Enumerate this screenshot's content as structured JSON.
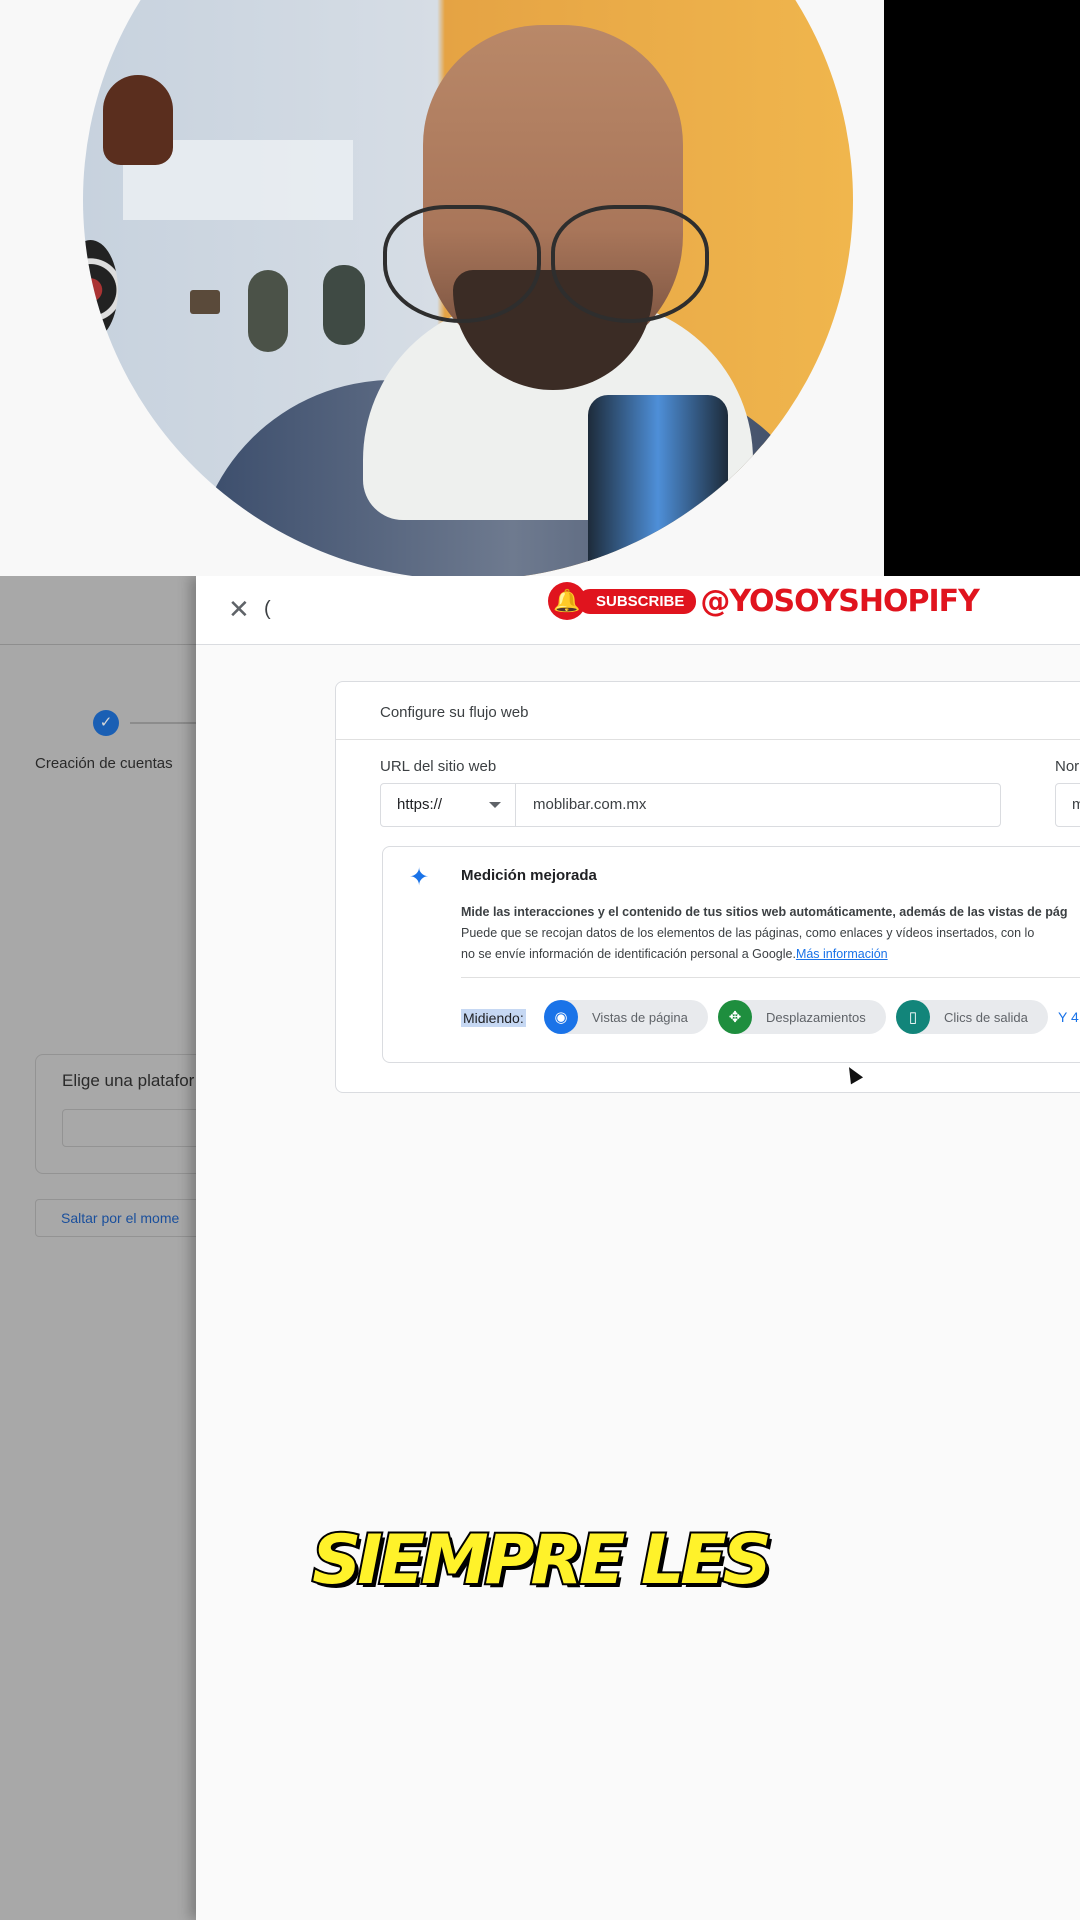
{
  "overlay": {
    "subscribe_label": "SUBSCRIBE",
    "channel_handle": "@YOSOYSHOPIFY",
    "caption": "SIEMPRE LES"
  },
  "background_page": {
    "step_label": "Creación de cuentas",
    "platform_card_title": "Elige una platafor",
    "skip_link": "Saltar por el mome"
  },
  "dialog": {
    "header_partial": "(",
    "card_title": "Configure su flujo web",
    "url_label": "URL del sitio web",
    "protocol_value": "https://",
    "url_value": "moblibar.com.mx",
    "name_label_partial": "Nor",
    "name_value_partial": "m",
    "enhanced": {
      "title": "Medición mejorada",
      "desc_line1": "Mide las interacciones y el contenido de tus sitios web automáticamente, además de las vistas de pág",
      "desc_line2": "Puede que se recojan datos de los elementos de las páginas, como enlaces y vídeos insertados, con lo",
      "desc_line3": "no se envíe información de identificación personal a Google.",
      "more_link": "Más información",
      "measuring_label": "Midiendo:",
      "chips": [
        {
          "label": "Vistas de página",
          "icon": "eye-icon",
          "color": "#1a73e8"
        },
        {
          "label": "Desplazamientos",
          "icon": "move-icon",
          "color": "#1e8e3e"
        },
        {
          "label": "Clics de salida",
          "icon": "mouse-icon",
          "color": "#12857a"
        }
      ],
      "more_count": "Y 4"
    }
  },
  "colors": {
    "accent_blue": "#1a73e8",
    "caption_yellow": "#fff22a",
    "subscribe_red": "#e0141e"
  }
}
